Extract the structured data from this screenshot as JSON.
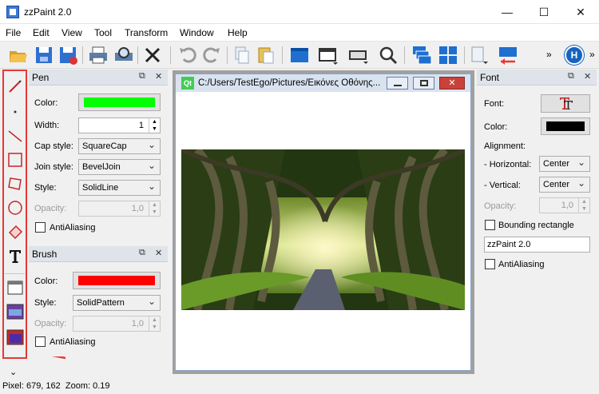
{
  "window": {
    "title": "zzPaint 2.0",
    "minimize": "—",
    "maximize": "☐",
    "close": "✕"
  },
  "menu": {
    "items": [
      "File",
      "Edit",
      "View",
      "Tool",
      "Transform",
      "Window",
      "Help"
    ]
  },
  "toolbar": {
    "overflow": "»",
    "overflow2": "»",
    "help_badge": "H"
  },
  "pen_dock": {
    "title": "Pen",
    "float": "⧉",
    "close": "✕",
    "color_label": "Color:",
    "color": "#00ff00",
    "width_label": "Width:",
    "width_value": "1",
    "cap_label": "Cap style:",
    "cap_value": "SquareCap",
    "join_label": "Join style:",
    "join_value": "BevelJoin",
    "style_label": "Style:",
    "style_value": "SolidLine",
    "opacity_label": "Opacity:",
    "opacity_value": "1,0",
    "antialias_label": "AntiAliasing"
  },
  "brush_dock": {
    "title": "Brush",
    "float": "⧉",
    "close": "✕",
    "color_label": "Color:",
    "color": "#ff0000",
    "style_label": "Style:",
    "style_value": "SolidPattern",
    "opacity_label": "Opacity:",
    "opacity_value": "1,0",
    "antialias_label": "AntiAliasing"
  },
  "font_dock": {
    "title": "Font",
    "float": "⧉",
    "close": "✕",
    "font_label": "Font:",
    "color_label": "Color:",
    "color": "#000000",
    "alignment_label": "Alignment:",
    "horizontal_label": "- Horizontal:",
    "horizontal_value": "Center",
    "vertical_label": "- Vertical:",
    "vertical_value": "Center",
    "opacity_label": "Opacity:",
    "opacity_value": "1,0",
    "bounding_label": "Bounding rectangle",
    "text_value": "zzPaint 2.0",
    "antialias_label": "AntiAliasing"
  },
  "subwindow": {
    "qt_badge": "Qt",
    "title": "C:/Users/TestEgo/Pictures/Εικόνες Οθόνης..."
  },
  "status": {
    "text": "Pixel: 679, 162  Zoom: 0.19"
  },
  "lefttools": {
    "more": "⌄"
  },
  "accent": {
    "highlight": "#e53935",
    "toolbar_blue": "#1e6fd0"
  }
}
